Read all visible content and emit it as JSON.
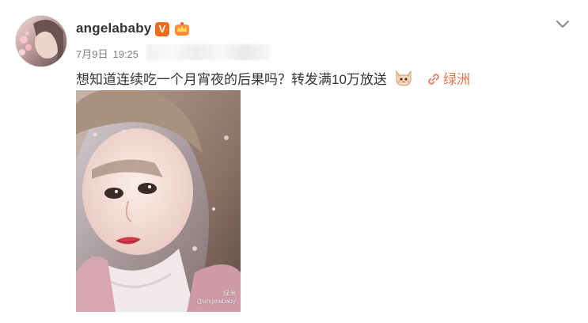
{
  "post": {
    "username": "angelababy",
    "verified_badge": "V",
    "date": "7月9日",
    "time": "19:25",
    "text": "想知道连续吃一个月宵夜的后果吗？转发满10万放送",
    "link_label": "绿洲"
  },
  "photo": {
    "watermark_line1": "绿洲",
    "watermark_line2": "@angelababy"
  },
  "icons": {
    "avatar": "avatar",
    "verified": "verified-v-icon",
    "crown": "member-crown-icon",
    "chevron": "chevron-down-icon",
    "emoji": "cat-emoji-icon",
    "link": "link-icon"
  },
  "colors": {
    "text": "#333333",
    "meta": "#808080",
    "link": "#eb7350",
    "verified": "#f26a1b"
  }
}
